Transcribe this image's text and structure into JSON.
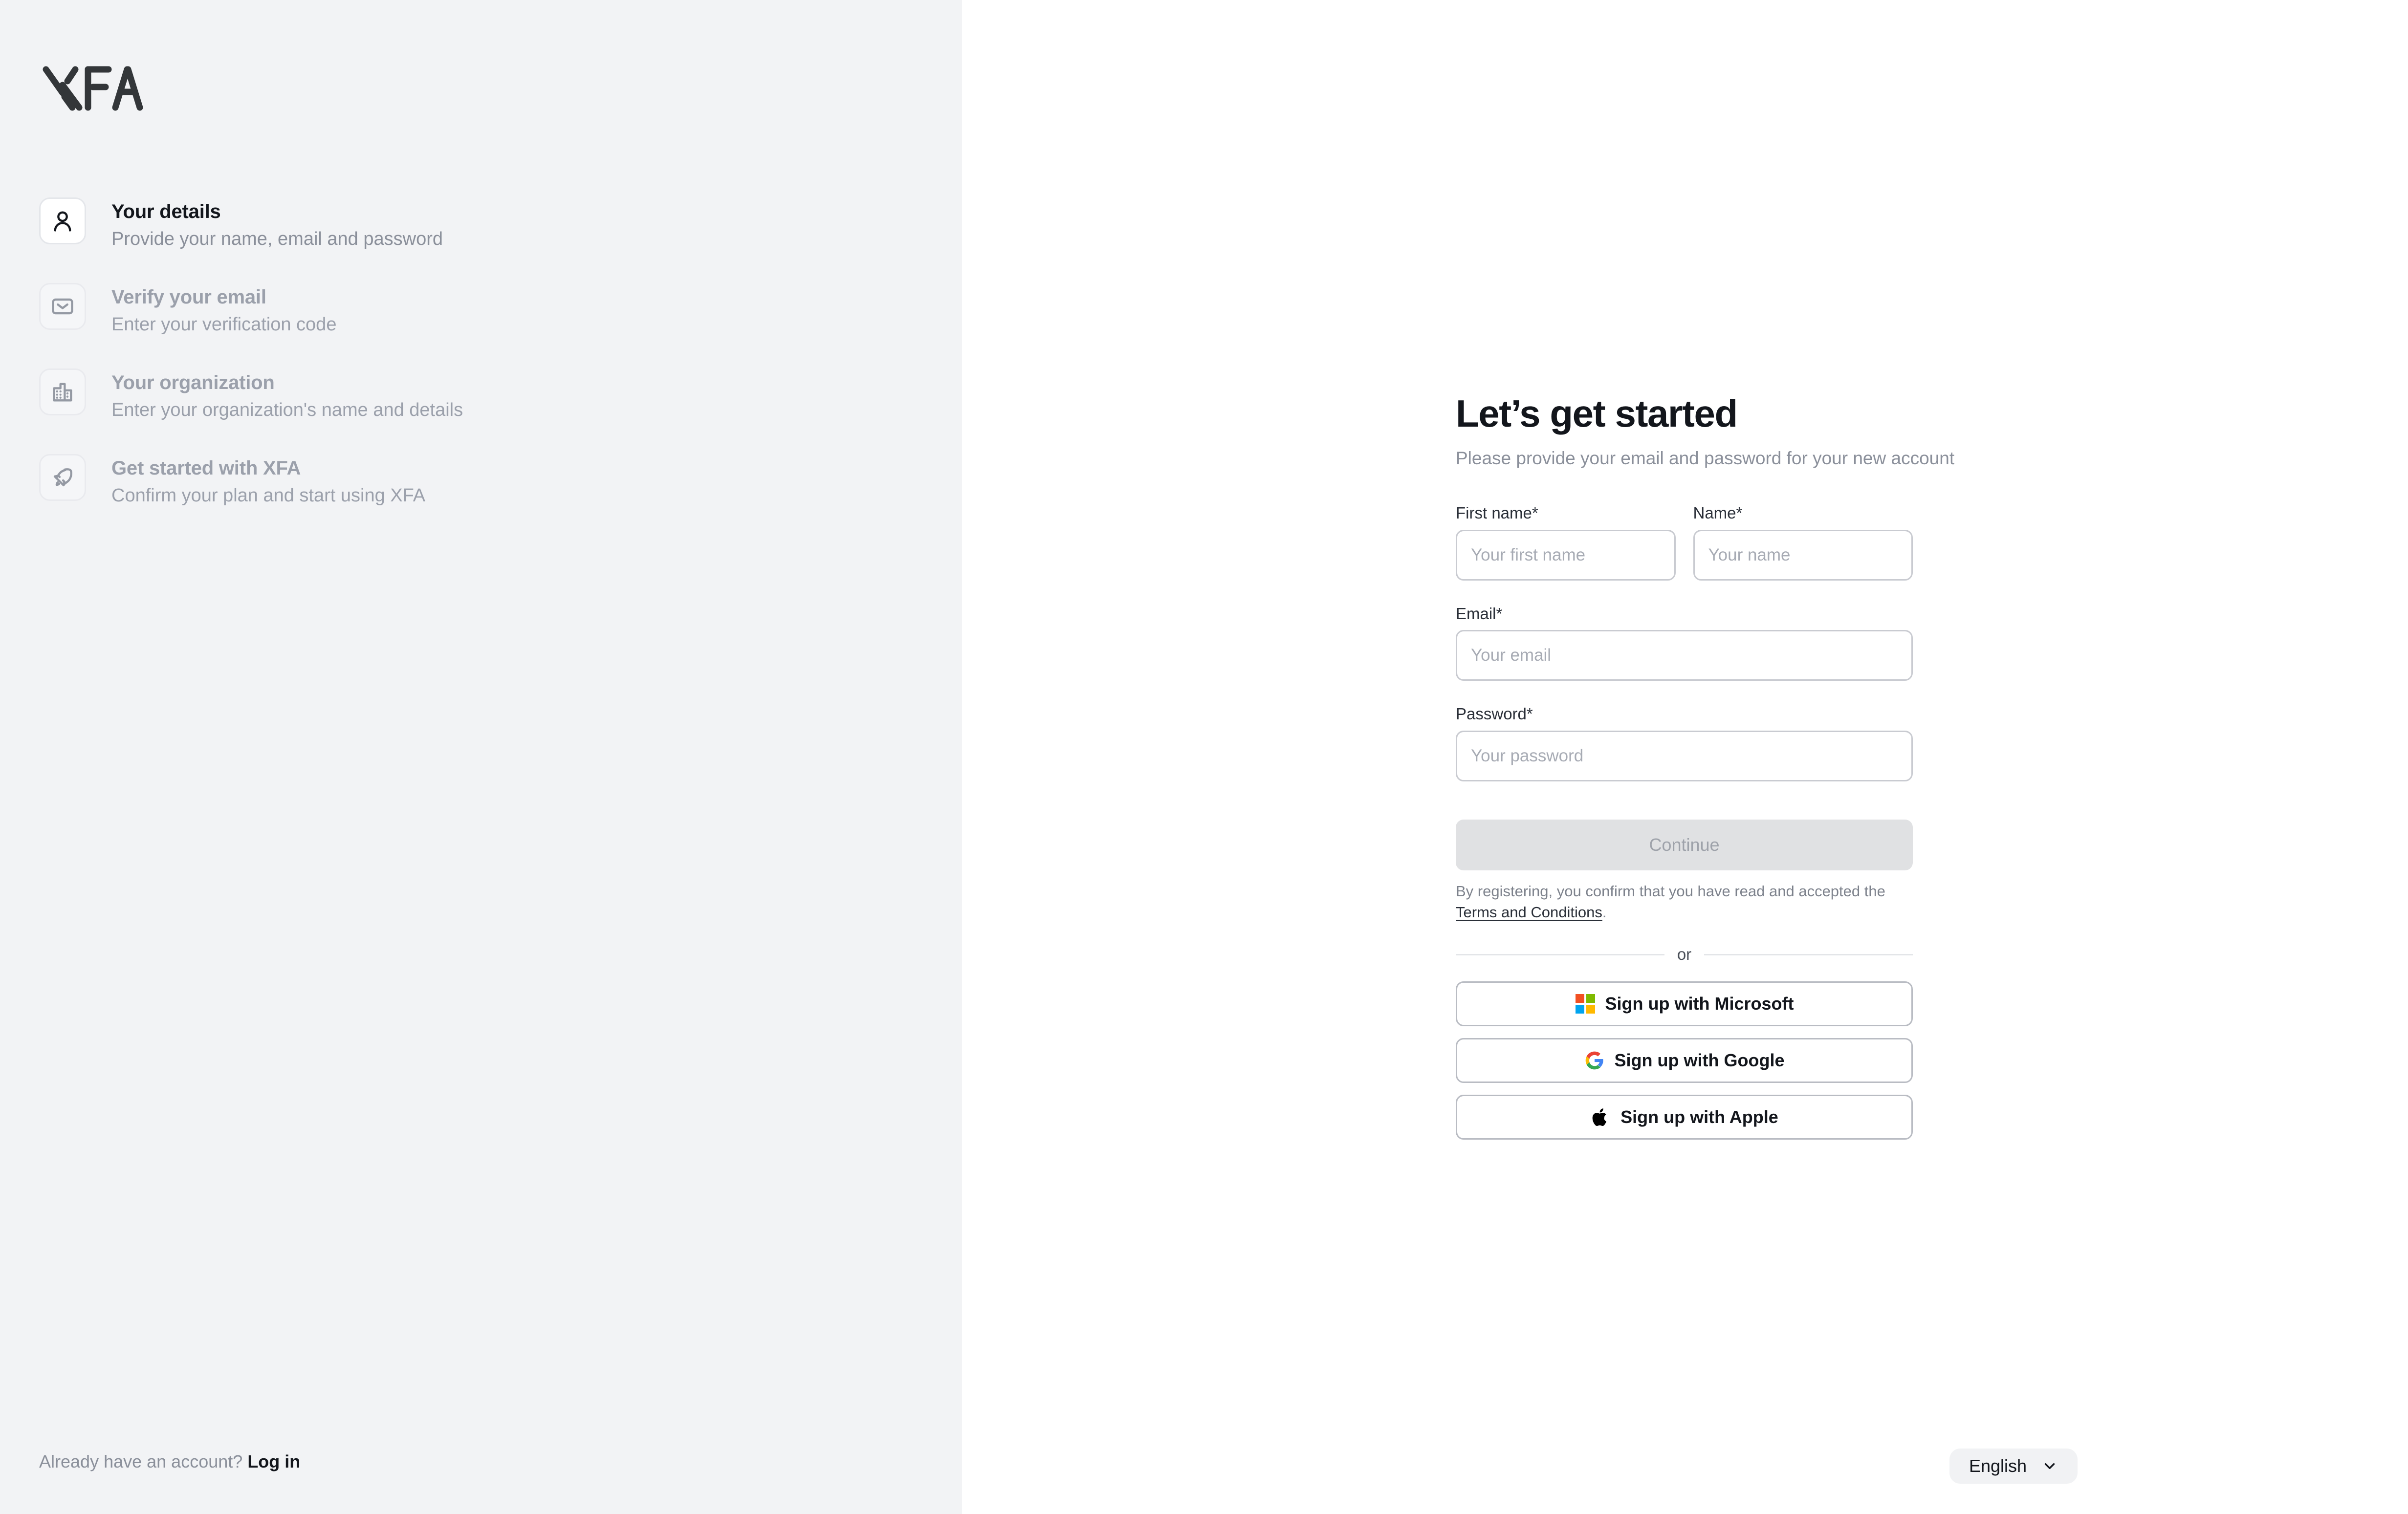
{
  "brand": {
    "logo_text": "XFA",
    "logo_icon": "xfa-wordmark-logo"
  },
  "sidebar": {
    "steps": [
      {
        "icon": "person-icon",
        "title": "Your details",
        "subtitle": "Provide your name, email and password",
        "state": "active"
      },
      {
        "icon": "envelope-icon",
        "title": "Verify your email",
        "subtitle": "Enter your verification code",
        "state": "upcoming"
      },
      {
        "icon": "building-icon",
        "title": "Your organization",
        "subtitle": "Enter your organization's name and details",
        "state": "upcoming"
      },
      {
        "icon": "rocket-icon",
        "title": "Get started with XFA",
        "subtitle": "Confirm your plan and start using XFA",
        "state": "upcoming"
      }
    ],
    "footer": {
      "prompt": "Already have an account?",
      "login_label": "Log in"
    }
  },
  "main": {
    "title": "Let’s get started",
    "subtitle": "Please provide your email and password for your new account",
    "fields": {
      "first_name": {
        "label": "First name*",
        "placeholder": "Your first name",
        "value": ""
      },
      "last_name": {
        "label": "Name*",
        "placeholder": "Your name",
        "value": ""
      },
      "email": {
        "label": "Email*",
        "placeholder": "Your email",
        "value": ""
      },
      "password": {
        "label": "Password*",
        "placeholder": "Your password",
        "value": ""
      }
    },
    "continue_label": "Continue",
    "terms": {
      "prefix": "By registering, you confirm that you have read and accepted the ",
      "link_label": "Terms and Conditions",
      "suffix": "."
    },
    "divider_label": "or",
    "social_buttons": [
      {
        "icon": "microsoft-icon",
        "label": "Sign up with Microsoft"
      },
      {
        "icon": "google-icon",
        "label": "Sign up with Google"
      },
      {
        "icon": "apple-icon",
        "label": "Sign up with Apple"
      }
    ]
  },
  "language_selector": {
    "value": "English",
    "icon": "chevron-down-icon"
  },
  "colors": {
    "sidebar_bg": "#f2f3f5",
    "main_bg": "#ffffff",
    "text_primary": "#13161c",
    "text_muted": "#8a8f9a",
    "input_border": "#c9cbd1",
    "button_disabled_bg": "#e0e1e3",
    "microsoft_red": "#f25022",
    "microsoft_green": "#7fba00",
    "microsoft_blue": "#00a4ef",
    "microsoft_yellow": "#ffb900",
    "google_blue": "#4285f4",
    "google_red": "#ea4335",
    "google_yellow": "#fbbc05",
    "google_green": "#34a853"
  }
}
